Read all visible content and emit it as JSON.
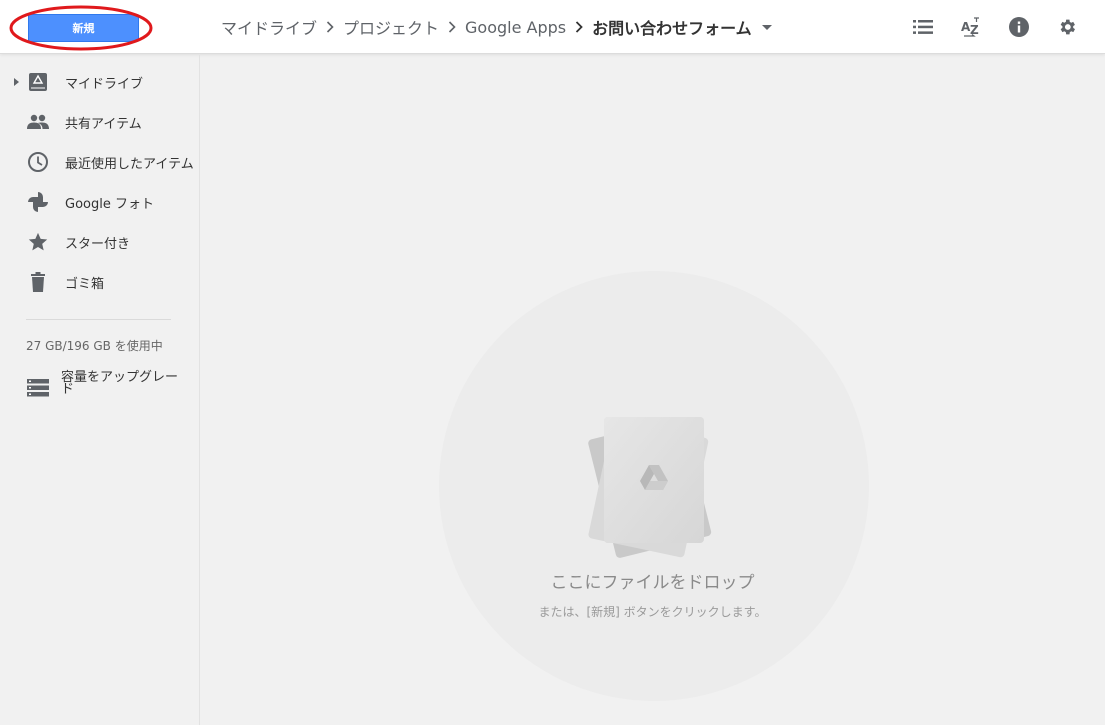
{
  "toolbar": {
    "new_label": "新規",
    "breadcrumb": [
      "マイドライブ",
      "プロジェクト",
      "Google Apps",
      "お問い合わせフォーム"
    ]
  },
  "sidebar": {
    "items": [
      {
        "label": "マイドライブ",
        "icon": "drive-icon"
      },
      {
        "label": "共有アイテム",
        "icon": "people-icon"
      },
      {
        "label": "最近使用したアイテム",
        "icon": "clock-icon"
      },
      {
        "label": "Google フォト",
        "icon": "photos-pinwheel-icon"
      },
      {
        "label": "スター付き",
        "icon": "star-icon"
      },
      {
        "label": "ゴミ箱",
        "icon": "trash-icon"
      }
    ],
    "storage": "27 GB/196 GB を使用中",
    "upgrade_label": "容量をアップグレード"
  },
  "main": {
    "drop_title": "ここにファイルをドロップ",
    "drop_subtitle": "または、[新規] ボタンをクリックします。"
  },
  "colors": {
    "accent": "#4d90fe",
    "annotation": "#e0191c"
  }
}
